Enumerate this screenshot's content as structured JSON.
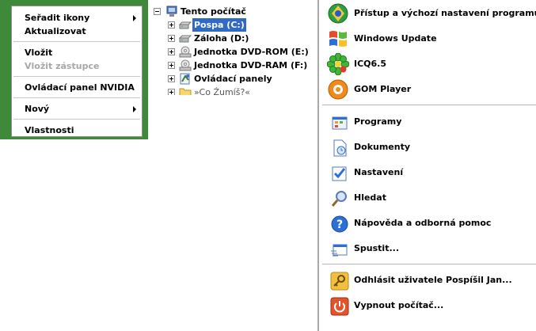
{
  "context_menu": {
    "items": [
      {
        "label": "Seřadit ikony",
        "submenu": true,
        "disabled": false
      },
      {
        "label": "Aktualizovat",
        "submenu": false,
        "disabled": false
      },
      {
        "label": "Vložit",
        "submenu": false,
        "disabled": false
      },
      {
        "label": "Vložit zástupce",
        "submenu": false,
        "disabled": true
      },
      {
        "label": "Ovládací panel NVIDIA",
        "submenu": false,
        "disabled": false
      },
      {
        "label": "Nový",
        "submenu": true,
        "disabled": false
      },
      {
        "label": "Vlastnosti",
        "submenu": false,
        "disabled": false
      }
    ]
  },
  "tree": {
    "root": {
      "label": "Tento počítač",
      "icon": "computer-icon"
    },
    "items": [
      {
        "label": "Pospa (C:)",
        "icon": "hard-drive-icon",
        "selected": true
      },
      {
        "label": "Záloha (D:)",
        "icon": "hard-drive-icon",
        "selected": false
      },
      {
        "label": "Jednotka DVD-ROM (E:)",
        "icon": "dvd-drive-icon",
        "selected": false
      },
      {
        "label": "Jednotka DVD-RAM (F:)",
        "icon": "dvd-drive-icon",
        "selected": false
      },
      {
        "label": "Ovládací panely",
        "icon": "control-panel-icon",
        "selected": false
      },
      {
        "label": "»Co Źumíš?«",
        "icon": "folder-icon",
        "selected": false
      }
    ]
  },
  "start_menu": {
    "pinned": [
      {
        "label": "Přístup a výchozí nastavení programů",
        "icon": "program-access-icon"
      },
      {
        "label": "Windows Update",
        "icon": "windows-update-icon"
      },
      {
        "label": "ICQ6.5",
        "icon": "icq-flower-icon"
      },
      {
        "label": "GOM Player",
        "icon": "gom-player-icon"
      }
    ],
    "places": [
      {
        "label": "Programy",
        "icon": "programs-icon"
      },
      {
        "label": "Dokumenty",
        "icon": "documents-icon"
      },
      {
        "label": "Nastavení",
        "icon": "settings-icon"
      },
      {
        "label": "Hledat",
        "icon": "search-icon"
      },
      {
        "label": "Nápověda a odborná pomoc",
        "icon": "help-icon"
      },
      {
        "label": "Spustit...",
        "icon": "run-icon"
      }
    ],
    "session": [
      {
        "label": "Odhlásit uživatele Pospíšil Jan...",
        "icon": "logoff-key-icon"
      },
      {
        "label": "Vypnout počítač...",
        "icon": "power-icon"
      }
    ]
  },
  "colors": {
    "desktop": "#3e8a3a",
    "selection": "#316ac5",
    "disabled_text": "#a7a7a7"
  }
}
